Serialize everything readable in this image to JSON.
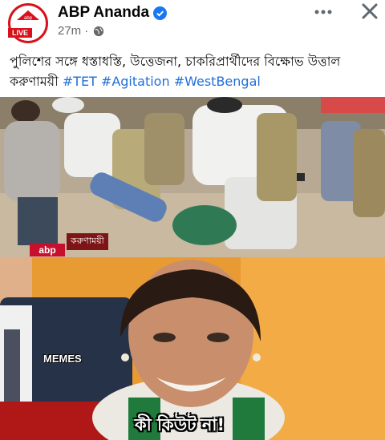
{
  "post": {
    "page_name": "ABP Ananda",
    "time": "27m",
    "live_label": "LIVE",
    "logo_text": "abp",
    "text_bengali": "পুলিশের সঙ্গে ধস্তাধস্তি, উত্তেজনা, চাকরিপ্রার্থীদের বিক্ষোভ উত্তাল করুণাময়ী",
    "hashtags": [
      "#TET",
      "#Agitation",
      "#WestBengal"
    ]
  },
  "image": {
    "top_channel_tag": "করুণাময়ী",
    "top_logo": "abp",
    "memes_label": "MEMES",
    "caption": "কী কিউট না!"
  },
  "colors": {
    "brand_red": "#d7121b",
    "link_blue": "#216fdb",
    "verified_blue": "#1877f2",
    "meta_gray": "#65676b"
  },
  "icons": [
    "more-icon",
    "close-icon",
    "globe-icon",
    "verified-icon"
  ]
}
